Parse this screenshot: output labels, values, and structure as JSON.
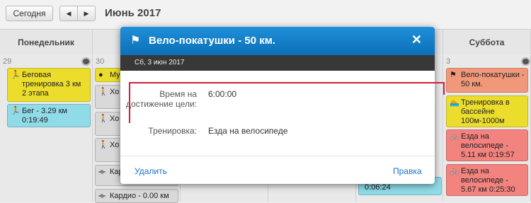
{
  "toolbar": {
    "today_label": "Сегодня",
    "prev_icon": "◀",
    "next_icon": "▶",
    "month_title": "Июнь 2017"
  },
  "days": {
    "monday": {
      "header": "Понедельник",
      "date": "29"
    },
    "tuesday": {
      "date": "30"
    },
    "saturday": {
      "header": "Суббота",
      "date": "3"
    }
  },
  "events": {
    "mon_1": {
      "icon": "runner-icon",
      "text": "Беговая тренировка 3 км 2 этапа"
    },
    "mon_2": {
      "icon": "runner-icon",
      "text": "Бег - 3.29 км 0:19:49"
    },
    "tue_1": {
      "text": "Му"
    },
    "tue_2": {
      "text": "Хо 0:"
    },
    "tue_3": {
      "text": "Хо 0:"
    },
    "tue_4": {
      "text": "Хо 0:"
    },
    "tue_5": {
      "text": "Кард"
    },
    "tue_6": {
      "text": "Кардио - 0.00 км"
    },
    "fri_1": {
      "text": "0:06:24"
    },
    "sat_1": {
      "icon": "flag-icon",
      "text": "Вело-покатушки - 50 км."
    },
    "sat_2": {
      "icon": "swimmer-icon",
      "text": "Тренировка в бассейне 100м-1000м"
    },
    "sat_3": {
      "icon": "bicycle-icon",
      "text": "Езда на велосипеде - 5.11 км 0:19:57"
    },
    "sat_4": {
      "icon": "bicycle-icon",
      "text": "Езда на велосипеде - 5.67 км 0:25:30"
    }
  },
  "modal": {
    "title": "Вело-покатушки - 50 км.",
    "close_icon": "✕",
    "date": "Сб, 3 июн 2017",
    "time_label": "Время на достижение цели:",
    "time_value": "6:00:00",
    "workout_label": "Тренировка:",
    "workout_value": "Езда на велосипеде",
    "delete_label": "Удалить",
    "edit_label": "Правка"
  },
  "colors": {
    "header_blue": "#1a84cf",
    "event_yellow": "#ecdd2d",
    "event_cyan": "#8fdbe8",
    "event_salmon": "#f2987a",
    "event_pink": "#f3837f",
    "highlight_red": "#d61c3a",
    "link_blue": "#1a73c8"
  }
}
